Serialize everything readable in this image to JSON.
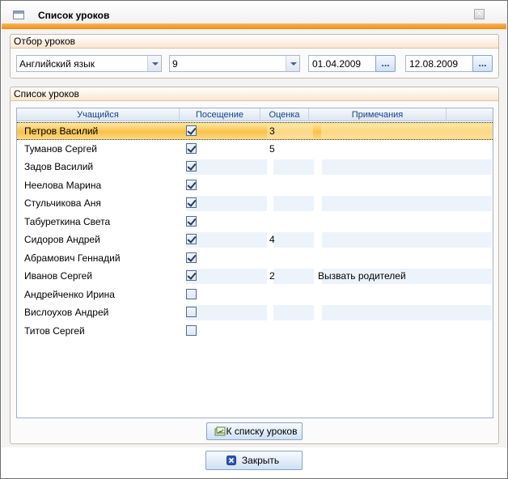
{
  "window": {
    "title": "Список уроков",
    "close_glyph": "✕"
  },
  "filter": {
    "header": "Отбор уроков",
    "subject": "Английский язык",
    "grade": "9",
    "date_from": "01.04.2009",
    "date_to": "12.08.2009",
    "date_button_label": "..."
  },
  "lessons": {
    "header": "Список уроков",
    "columns": [
      "Учащийся",
      "Посещение",
      "Оценка",
      "Примечания"
    ],
    "rows": [
      {
        "student": "Петров Василий",
        "attended": true,
        "grade": "3",
        "note": ""
      },
      {
        "student": "Туманов Сергей",
        "attended": true,
        "grade": "5",
        "note": ""
      },
      {
        "student": "Задов Василий",
        "attended": true,
        "grade": "",
        "note": ""
      },
      {
        "student": "Неелова Марина",
        "attended": true,
        "grade": "",
        "note": ""
      },
      {
        "student": "Стульчикова Аня",
        "attended": true,
        "grade": "",
        "note": ""
      },
      {
        "student": "Табуреткина Света",
        "attended": true,
        "grade": "",
        "note": ""
      },
      {
        "student": "Сидоров Андрей",
        "attended": true,
        "grade": "4",
        "note": ""
      },
      {
        "student": "Абрамович Геннадий",
        "attended": true,
        "grade": "",
        "note": ""
      },
      {
        "student": "Иванов Сергей",
        "attended": true,
        "grade": "2",
        "note": "Вызвать родителей"
      },
      {
        "student": "Андрейченко Ирина",
        "attended": false,
        "grade": "",
        "note": ""
      },
      {
        "student": "Вислоухов Андрей",
        "attended": false,
        "grade": "",
        "note": ""
      },
      {
        "student": "Титов Сергей",
        "attended": false,
        "grade": "",
        "note": ""
      }
    ],
    "selected_row": 0
  },
  "buttons": {
    "to_list": "К списку уроков",
    "close": "Закрыть"
  },
  "colors": {
    "accent": "#f08a16",
    "selection": "#f8c24a",
    "header_text": "#15428b"
  }
}
